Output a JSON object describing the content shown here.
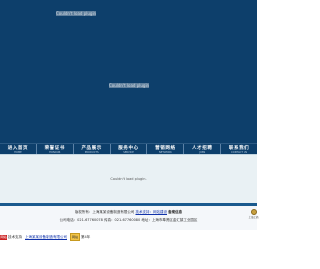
{
  "hero": {
    "plugin_label_top": "Couldn't load plugin.",
    "plugin_label_mid": "Couldn't load plugin."
  },
  "nav": {
    "items": [
      {
        "cn": "进入首页",
        "en": "HOME"
      },
      {
        "cn": "荣誉证书",
        "en": "HONOUR"
      },
      {
        "cn": "产品展示",
        "en": "PRODUCTS"
      },
      {
        "cn": "服务中心",
        "en": "SERVICE"
      },
      {
        "cn": "营销网络",
        "en": "NETWORK"
      },
      {
        "cn": "人才招聘",
        "en": "JOBS"
      },
      {
        "cn": "联系我们",
        "en": "CONTACT US"
      }
    ]
  },
  "plugin_area": {
    "message": "Couldn't load plugin."
  },
  "footer": {
    "line1_prefix": "版权所有：上海某某设备制造有限公司",
    "line1_link": "技术支持：网站建设",
    "line1_suffix": "备案信息",
    "line2": "公司电话：021-67760078  传真：021-67760080  地址：上海市奉贤区金汇镇工业园区",
    "badge_text": "上海工商"
  },
  "bottom_bar": {
    "logo_text": "网站",
    "label": "技术支持",
    "link": "上海某某设备制造有限公司",
    "badge_text": "网站",
    "badge_suffix": "第4年"
  },
  "colors": {
    "hero_bg": "#0d3f6b",
    "nav_bg": "#0d3f6b",
    "plugin_bg": "#e9f1f4",
    "accent": "#1a5a8e"
  }
}
